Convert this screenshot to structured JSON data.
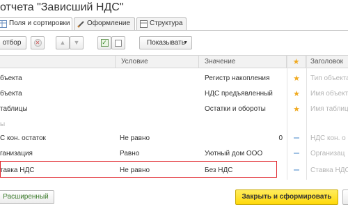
{
  "title": "отчета \"Зависший НДС\"",
  "tabs": [
    {
      "label": "Поля и сортировки",
      "icon": "table-icon"
    },
    {
      "label": "Оформление",
      "icon": "brush-icon"
    },
    {
      "label": "Структура",
      "icon": "structure-icon"
    }
  ],
  "toolbar": {
    "filter_label": "отбор",
    "show_label": "Показывать"
  },
  "table": {
    "headers": {
      "field": "",
      "condition": "Условие",
      "value": "Значение",
      "header": "Заголовок"
    },
    "rows": [
      {
        "field": "бъекта",
        "condition": "",
        "value": "Регистр накопления",
        "value_num": "",
        "mark": "star",
        "header": "Тип объекта"
      },
      {
        "field": "бъекта",
        "condition": "",
        "value": "НДС предъявленный",
        "value_num": "",
        "mark": "star",
        "header": "Имя объекта"
      },
      {
        "field": "таблицы",
        "condition": "",
        "value": "Остатки и обороты",
        "value_num": "",
        "mark": "star",
        "header": "Имя таблицы"
      },
      {
        "field": "ы",
        "condition": "",
        "value": "",
        "value_num": "",
        "mark": "",
        "header": ""
      },
      {
        "field": "С кон. остаток",
        "condition": "Не равно",
        "value": "",
        "value_num": "0",
        "mark": "dash",
        "header": "НДС кон. о"
      },
      {
        "field": "ганизация",
        "condition": "Равно",
        "value": "Уютный дом ООО",
        "value_num": "",
        "mark": "dash",
        "header": "Организац"
      },
      {
        "field": "тавка НДС",
        "condition": "Не равно",
        "value": "Без НДС",
        "value_num": "",
        "mark": "dash",
        "header": "Ставка НДС"
      }
    ]
  },
  "footer": {
    "advanced_label": "Расширенный",
    "close_generate_label": "Закрыть и сформировать"
  },
  "colors": {
    "accent_yellow": "#ffd90a",
    "highlight_red": "#e0242b",
    "star": "#f0a91e"
  }
}
